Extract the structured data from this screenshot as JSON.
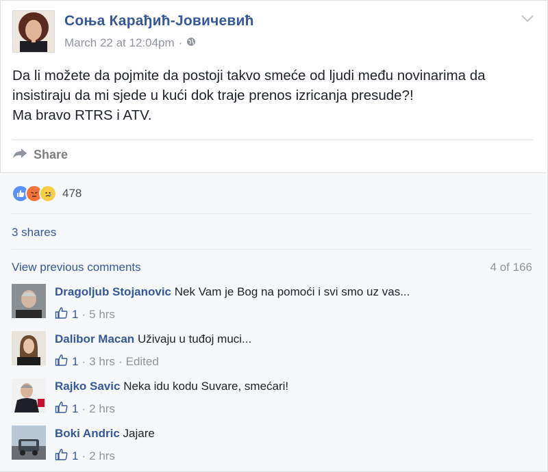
{
  "post": {
    "author": "Соња Карађић-Јовичевић",
    "timestamp": "March 22 at 12:04pm",
    "separator": "·",
    "lines": [
      "Da li možete da pojmite da postoji takvo smeće od ljudi među novinarima da",
      "insistiraju da mi sjede u kući dok traje prenos izricanja presude?!",
      "Ma bravo RTRS i ATV."
    ],
    "share_label": "Share"
  },
  "reactions": {
    "count": "478",
    "types": [
      "like",
      "angry",
      "sad"
    ]
  },
  "shares_label": "3 shares",
  "comments_header": {
    "view_previous": "View previous comments",
    "count": "4 of 166"
  },
  "comments": [
    {
      "name": "Dragoljub Stojanovic",
      "text": "Nek Vam je Bog na pomoći i svi smo uz vas...",
      "likes": "1",
      "time": "5 hrs",
      "edited": ""
    },
    {
      "name": "Dalibor Macan",
      "text": "Uživaju u tuđoj muci...",
      "likes": "1",
      "time": "3 hrs",
      "edited": "Edited"
    },
    {
      "name": "Rajko Savic",
      "text": "Neka idu kodu Suvare, smećari!",
      "likes": "1",
      "time": "2 hrs",
      "edited": ""
    },
    {
      "name": "Boki Andric",
      "text": "Jajare",
      "likes": "1",
      "time": "2 hrs",
      "edited": ""
    }
  ],
  "icons": {
    "globe": "globe-icon",
    "chevron": "chevron-down-icon",
    "share": "share-arrow-icon",
    "like": "thumbs-up-icon"
  },
  "colors": {
    "link": "#365899",
    "meta": "#90949c",
    "text": "#1d2129",
    "footer_bg": "#f6f7f9"
  }
}
